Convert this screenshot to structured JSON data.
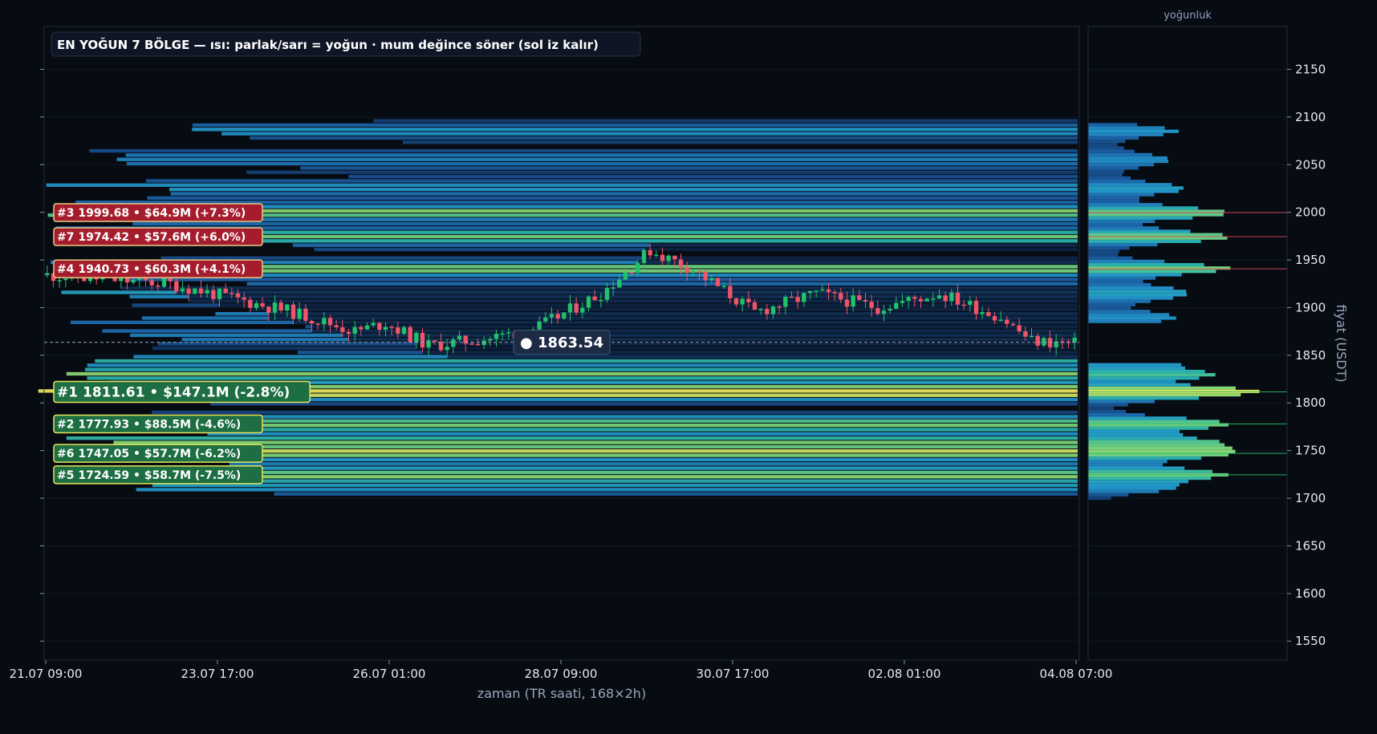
{
  "chart_data": {
    "type": "candlestick-heatmap",
    "title": "EN YOĞUN 7 BÖLGE — ısı: parlak/sarı = yoğun · mum değince söner (sol iz kalır)",
    "xlabel": "zaman (TR saati, 168×2h)",
    "ylabel": "fiyat (USDT)",
    "side_label": "yoğunluk",
    "ylim": [
      1530,
      2195
    ],
    "y_ticks": [
      1550,
      1600,
      1650,
      1700,
      1750,
      1800,
      1850,
      1900,
      1950,
      2000,
      2050,
      2100,
      2150
    ],
    "x_ticks": [
      "21.07 09:00",
      "23.07 17:00",
      "26.07 01:00",
      "28.07 09:00",
      "30.07 17:00",
      "02.08 01:00",
      "04.08 07:00"
    ],
    "current_price": 1863.54,
    "current_price_label": "● 1863.54",
    "zones": [
      {
        "rank": "#3",
        "price": 1999.68,
        "text": "#3  1999.68  •  $64.9M  (+7.3%)",
        "side": "above"
      },
      {
        "rank": "#7",
        "price": 1974.42,
        "text": "#7  1974.42  •  $57.6M  (+6.0%)",
        "side": "above"
      },
      {
        "rank": "#4",
        "price": 1940.73,
        "text": "#4  1940.73  •  $60.3M  (+4.1%)",
        "side": "above"
      },
      {
        "rank": "#1",
        "price": 1811.61,
        "text": "#1  1811.61  •  $147.1M  (-2.8%)",
        "side": "below",
        "major": true
      },
      {
        "rank": "#2",
        "price": 1777.93,
        "text": "#2  1777.93  •  $88.5M  (-4.6%)",
        "side": "below"
      },
      {
        "rank": "#6",
        "price": 1747.05,
        "text": "#6  1747.05  •  $57.7M  (-6.2%)",
        "side": "below"
      },
      {
        "rank": "#5",
        "price": 1724.59,
        "text": "#5  1724.59  •  $58.7M  (-7.5%)",
        "side": "below"
      }
    ],
    "candle_count": 168,
    "candle_anchors": [
      [
        0,
        1934
      ],
      [
        20,
        1925
      ],
      [
        40,
        1895
      ],
      [
        50,
        1875
      ],
      [
        55,
        1884
      ],
      [
        62,
        1860
      ],
      [
        72,
        1868
      ],
      [
        80,
        1880
      ],
      [
        90,
        1915
      ],
      [
        98,
        1960
      ],
      [
        105,
        1940
      ],
      [
        115,
        1895
      ],
      [
        125,
        1915
      ],
      [
        135,
        1900
      ],
      [
        145,
        1915
      ],
      [
        155,
        1890
      ],
      [
        160,
        1865
      ],
      [
        167,
        1862
      ]
    ],
    "colors": {
      "background": "#070b12",
      "up": "#22c16b",
      "down": "#f05468",
      "above_zone": "#a51d2d",
      "below_zone": "#1d6e43",
      "heat_low": "#0f2a52",
      "heat_mid": "#1f7fc0",
      "heat_high": "#e8e35a"
    }
  }
}
